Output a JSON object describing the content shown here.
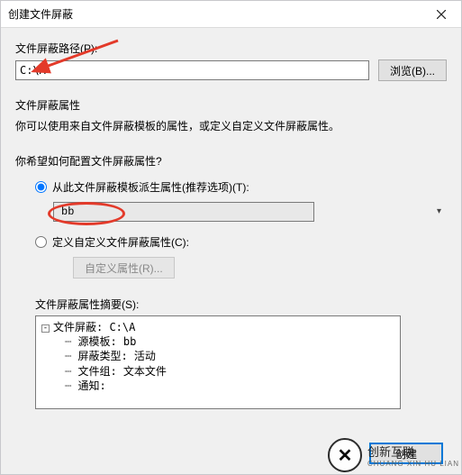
{
  "titlebar": {
    "title": "创建文件屏蔽"
  },
  "path": {
    "label": "文件屏蔽路径(P):",
    "value": "C:\\A",
    "browse_btn": "浏览(B)..."
  },
  "properties": {
    "heading": "文件屏蔽属性",
    "description": "你可以使用来自文件屏蔽模板的属性，或定义自定义文件屏蔽属性。",
    "question": "你希望如何配置文件屏蔽属性?",
    "radio_template": {
      "label": "从此文件屏蔽模板派生属性(推荐选项)(T):",
      "checked": true,
      "dropdown_value": "bb"
    },
    "radio_custom": {
      "label": "定义自定义文件屏蔽属性(C):",
      "checked": false
    },
    "custom_btn": "自定义属性(R)..."
  },
  "summary": {
    "label": "文件屏蔽属性摘要(S):",
    "root": "文件屏蔽: C:\\A",
    "children": [
      "源模板: bb",
      "屏蔽类型: 活动",
      "文件组: 文本文件",
      "通知:"
    ]
  },
  "footer": {
    "create_btn": "创建"
  },
  "watermark": {
    "brand": "创新互联",
    "sub": "CHUANG XIN HU LIAN"
  }
}
